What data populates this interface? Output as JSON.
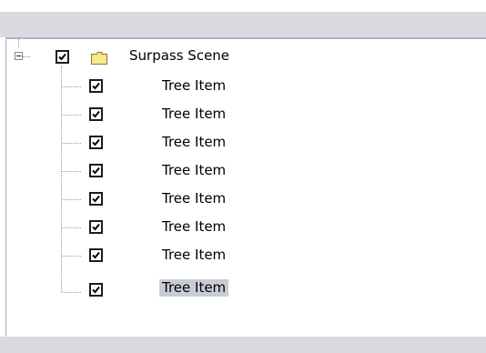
{
  "tree": {
    "root": {
      "label": "Surpass Scene",
      "checked": true,
      "expanded": true,
      "icon": "folder-icon"
    },
    "children": [
      {
        "label": "Tree Item",
        "checked": true,
        "selected": false
      },
      {
        "label": "Tree Item",
        "checked": true,
        "selected": false
      },
      {
        "label": "Tree Item",
        "checked": true,
        "selected": false
      },
      {
        "label": "Tree Item",
        "checked": true,
        "selected": false
      },
      {
        "label": "Tree Item",
        "checked": true,
        "selected": false
      },
      {
        "label": "Tree Item",
        "checked": true,
        "selected": false
      },
      {
        "label": "Tree Item",
        "checked": true,
        "selected": false
      },
      {
        "label": "Tree Item",
        "checked": true,
        "selected": true
      }
    ]
  },
  "colors": {
    "header_strip": "#d9dbe0",
    "selection_background": "#c8ccd3",
    "folder_fill": "#f3e27a"
  }
}
